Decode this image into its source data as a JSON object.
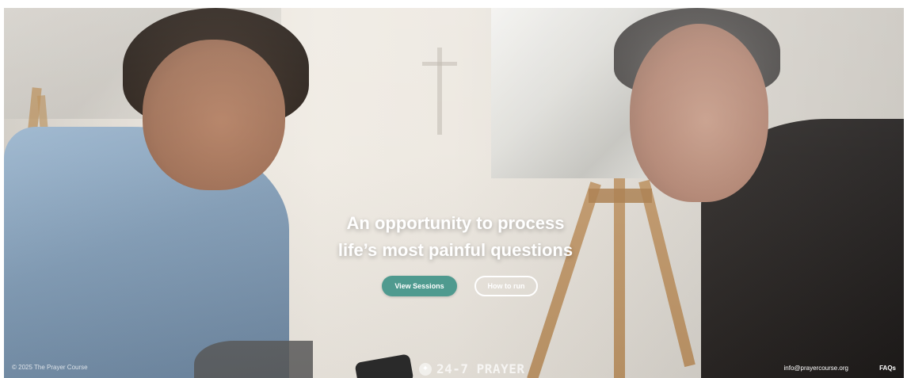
{
  "hero": {
    "headline_line1": "An opportunity to process",
    "headline_line2": "life’s most painful questions",
    "buttons": {
      "view_sessions": "View Sessions",
      "how_to_run": "How to run"
    }
  },
  "footer": {
    "copyright": "© 2025 The Prayer Course",
    "brand": "24-7 PRAYER",
    "email": "info@prayercourse.org",
    "faqs": "FAQs"
  },
  "colors": {
    "primary_button": "#4f9a8f",
    "text_on_image": "#ffffff"
  },
  "icons": {
    "brand_logo": "prayer-logo-icon"
  }
}
